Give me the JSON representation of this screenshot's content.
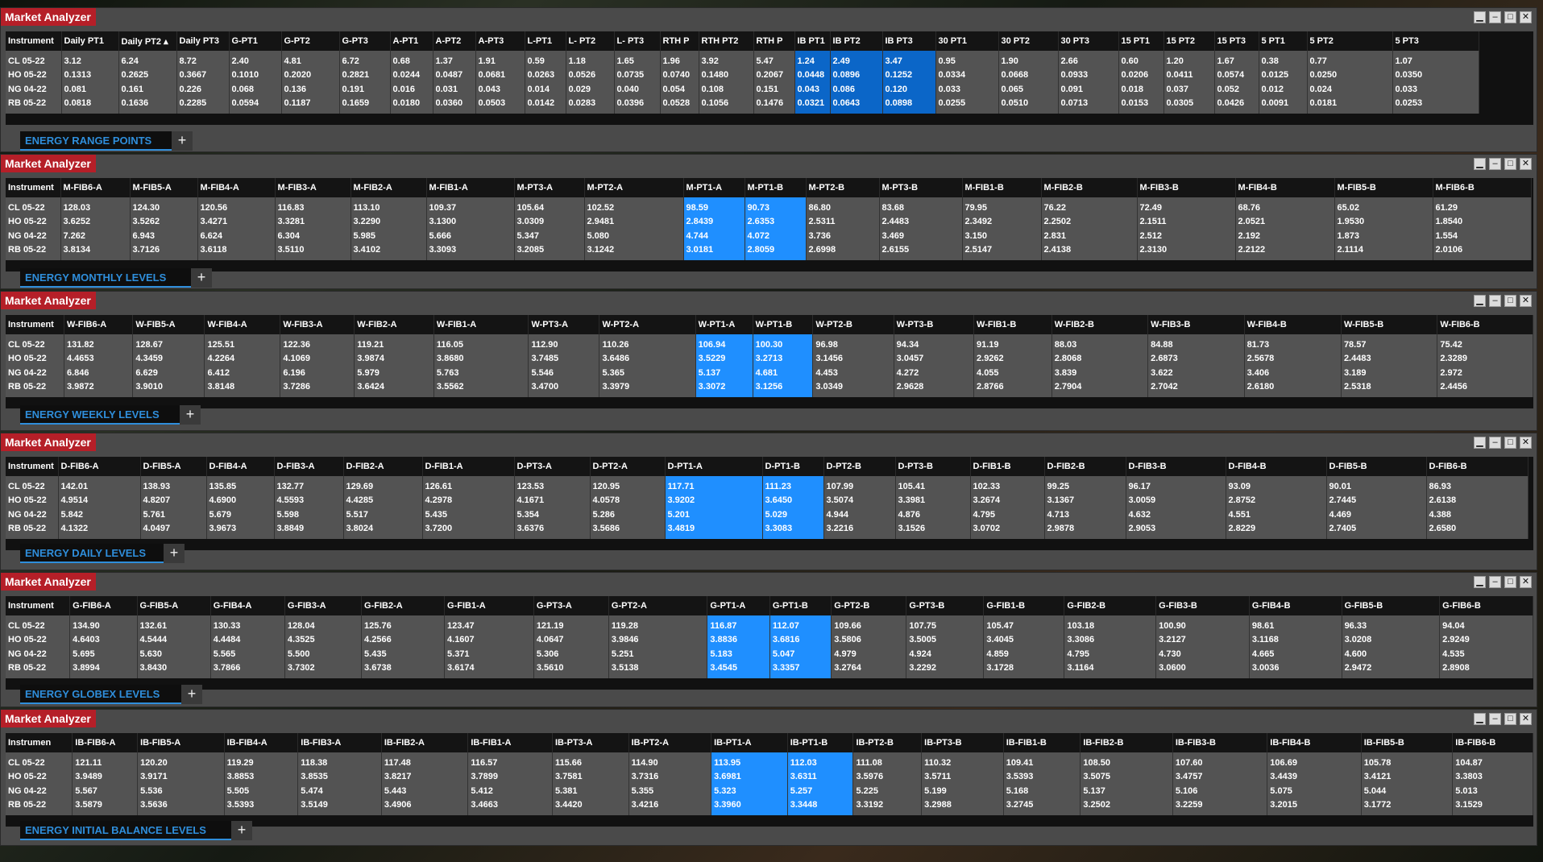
{
  "colors": {
    "title_bg": "#b51f28",
    "highlight": "#1f8fff",
    "tab_text": "#2f8edb"
  },
  "icons": {
    "minimize": "minimize-icon",
    "restore": "restore-icon",
    "maximize": "maximize-icon",
    "close": "close-icon"
  },
  "ctrl_glyphs": {
    "minimize": "▁",
    "restore": "–",
    "maximize": "□",
    "close": "✕"
  },
  "panels": [
    {
      "title": "Market Analyzer",
      "tab_label": "ENERGY RANGE POINTS",
      "add_label": "+",
      "columns": [
        "Instrument",
        "Daily PT1",
        "Daily PT2 ▴",
        "Daily PT3",
        "G-PT1",
        "G-PT2",
        "G-PT3",
        "A-PT1",
        "A-PT2",
        "A-PT3",
        "L-PT1",
        "L- PT2",
        "L- PT3",
        "RTH P",
        "RTH PT2",
        "RTH P",
        "IB PT1",
        "IB PT2",
        "IB PT3",
        "30 PT1",
        "30 PT2",
        "30 PT3",
        "15 PT1",
        "15 PT2",
        "15 PT3",
        "5 PT1",
        "5 PT2",
        "5 PT3"
      ],
      "rows": [
        [
          "CL 05-22",
          "3.12",
          "6.24",
          "8.72",
          "2.40",
          "4.81",
          "6.72",
          "0.68",
          "1.37",
          "1.91",
          "0.59",
          "1.18",
          "1.65",
          "1.96",
          "3.92",
          "5.47",
          "1.24",
          "2.49",
          "3.47",
          "0.95",
          "1.90",
          "2.66",
          "0.60",
          "1.20",
          "1.67",
          "0.38",
          "0.77",
          "1.07"
        ],
        [
          "HO 05-22",
          "0.1313",
          "0.2625",
          "0.3667",
          "0.1010",
          "0.2020",
          "0.2821",
          "0.0244",
          "0.0487",
          "0.0681",
          "0.0263",
          "0.0526",
          "0.0735",
          "0.0740",
          "0.1480",
          "0.2067",
          "0.0448",
          "0.0896",
          "0.1252",
          "0.0334",
          "0.0668",
          "0.0933",
          "0.0206",
          "0.0411",
          "0.0574",
          "0.0125",
          "0.0250",
          "0.0350"
        ],
        [
          "NG 04-22",
          "0.081",
          "0.161",
          "0.226",
          "0.068",
          "0.136",
          "0.191",
          "0.016",
          "0.031",
          "0.043",
          "0.014",
          "0.029",
          "0.040",
          "0.054",
          "0.108",
          "0.151",
          "0.043",
          "0.086",
          "0.120",
          "0.033",
          "0.065",
          "0.091",
          "0.018",
          "0.037",
          "0.052",
          "0.012",
          "0.024",
          "0.033"
        ],
        [
          "RB 05-22",
          "0.0818",
          "0.1636",
          "0.2285",
          "0.0594",
          "0.1187",
          "0.1659",
          "0.0180",
          "0.0360",
          "0.0503",
          "0.0142",
          "0.0283",
          "0.0396",
          "0.0528",
          "0.1056",
          "0.1476",
          "0.0321",
          "0.0643",
          "0.0898",
          "0.0255",
          "0.0510",
          "0.0713",
          "0.0153",
          "0.0305",
          "0.0426",
          "0.0091",
          "0.0181",
          "0.0253"
        ]
      ]
    },
    {
      "title": "Market Analyzer",
      "tab_label": "ENERGY MONTHLY LEVELS",
      "add_label": "+",
      "columns": [
        "Instrument",
        "M-FIB6-A",
        "M-FIB5-A",
        "M-FIB4-A",
        "M-FIB3-A",
        "M-FIB2-A",
        "M-FIB1-A",
        "M-PT3-A",
        "M-PT2-A",
        "M-PT1-A",
        "M-PT1-B",
        "M-PT2-B",
        "M-PT3-B",
        "M-FIB1-B",
        "M-FIB2-B",
        "M-FIB3-B",
        "M-FIB4-B",
        "M-FIB5-B",
        "M-FIB6-B"
      ],
      "rows": [
        [
          "CL 05-22",
          "128.03",
          "124.30",
          "120.56",
          "116.83",
          "113.10",
          "109.37",
          "105.64",
          "102.52",
          "98.59",
          "90.73",
          "86.80",
          "83.68",
          "79.95",
          "76.22",
          "72.49",
          "68.76",
          "65.02",
          "61.29"
        ],
        [
          "HO 05-22",
          "3.6252",
          "3.5262",
          "3.4271",
          "3.3281",
          "3.2290",
          "3.1300",
          "3.0309",
          "2.9481",
          "2.8439",
          "2.6353",
          "2.5311",
          "2.4483",
          "2.3492",
          "2.2502",
          "2.1511",
          "2.0521",
          "1.9530",
          "1.8540"
        ],
        [
          "NG 04-22",
          "7.262",
          "6.943",
          "6.624",
          "6.304",
          "5.985",
          "5.666",
          "5.347",
          "5.080",
          "4.744",
          "4.072",
          "3.736",
          "3.469",
          "3.150",
          "2.831",
          "2.512",
          "2.192",
          "1.873",
          "1.554"
        ],
        [
          "RB 05-22",
          "3.8134",
          "3.7126",
          "3.6118",
          "3.5110",
          "3.4102",
          "3.3093",
          "3.2085",
          "3.1242",
          "3.0181",
          "2.8059",
          "2.6998",
          "2.6155",
          "2.5147",
          "2.4138",
          "2.3130",
          "2.2122",
          "2.1114",
          "2.0106"
        ]
      ]
    },
    {
      "title": "Market Analyzer",
      "tab_label": "ENERGY WEEKLY LEVELS",
      "add_label": "+",
      "columns": [
        "Instrument",
        "W-FIB6-A",
        "W-FIB5-A",
        "W-FIB4-A",
        "W-FIB3-A",
        "W-FIB2-A",
        "W-FIB1-A",
        "W-PT3-A",
        "W-PT2-A",
        "W-PT1-A",
        "W-PT1-B",
        "W-PT2-B",
        "W-PT3-B",
        "W-FIB1-B",
        "W-FIB2-B",
        "W-FIB3-B",
        "W-FIB4-B",
        "W-FIB5-B",
        "W-FIB6-B"
      ],
      "rows": [
        [
          "CL 05-22",
          "131.82",
          "128.67",
          "125.51",
          "122.36",
          "119.21",
          "116.05",
          "112.90",
          "110.26",
          "106.94",
          "100.30",
          "96.98",
          "94.34",
          "91.19",
          "88.03",
          "84.88",
          "81.73",
          "78.57",
          "75.42"
        ],
        [
          "HO 05-22",
          "4.4653",
          "4.3459",
          "4.2264",
          "4.1069",
          "3.9874",
          "3.8680",
          "3.7485",
          "3.6486",
          "3.5229",
          "3.2713",
          "3.1456",
          "3.0457",
          "2.9262",
          "2.8068",
          "2.6873",
          "2.5678",
          "2.4483",
          "2.3289"
        ],
        [
          "NG 04-22",
          "6.846",
          "6.629",
          "6.412",
          "6.196",
          "5.979",
          "5.763",
          "5.546",
          "5.365",
          "5.137",
          "4.681",
          "4.453",
          "4.272",
          "4.055",
          "3.839",
          "3.622",
          "3.406",
          "3.189",
          "2.972"
        ],
        [
          "RB 05-22",
          "3.9872",
          "3.9010",
          "3.8148",
          "3.7286",
          "3.6424",
          "3.5562",
          "3.4700",
          "3.3979",
          "3.3072",
          "3.1256",
          "3.0349",
          "2.9628",
          "2.8766",
          "2.7904",
          "2.7042",
          "2.6180",
          "2.5318",
          "2.4456"
        ]
      ]
    },
    {
      "title": "Market Analyzer",
      "tab_label": "ENERGY DAILY LEVELS",
      "add_label": "+",
      "columns": [
        "Instrument",
        "D-FIB6-A",
        "D-FIB5-A",
        "D-FIB4-A",
        "D-FIB3-A",
        "D-FIB2-A",
        "D-FIB1-A",
        "D-PT3-A",
        "D-PT2-A",
        "D-PT1-A",
        "D-PT1-B",
        "D-PT2-B",
        "D-PT3-B",
        "D-FIB1-B",
        "D-FIB2-B",
        "D-FIB3-B",
        "D-FIB4-B",
        "D-FIB5-B",
        "D-FIB6-B"
      ],
      "rows": [
        [
          "CL 05-22",
          "142.01",
          "138.93",
          "135.85",
          "132.77",
          "129.69",
          "126.61",
          "123.53",
          "120.95",
          "117.71",
          "111.23",
          "107.99",
          "105.41",
          "102.33",
          "99.25",
          "96.17",
          "93.09",
          "90.01",
          "86.93"
        ],
        [
          "HO 05-22",
          "4.9514",
          "4.8207",
          "4.6900",
          "4.5593",
          "4.4285",
          "4.2978",
          "4.1671",
          "4.0578",
          "3.9202",
          "3.6450",
          "3.5074",
          "3.3981",
          "3.2674",
          "3.1367",
          "3.0059",
          "2.8752",
          "2.7445",
          "2.6138"
        ],
        [
          "NG 04-22",
          "5.842",
          "5.761",
          "5.679",
          "5.598",
          "5.517",
          "5.435",
          "5.354",
          "5.286",
          "5.201",
          "5.029",
          "4.944",
          "4.876",
          "4.795",
          "4.713",
          "4.632",
          "4.551",
          "4.469",
          "4.388"
        ],
        [
          "RB 05-22",
          "4.1322",
          "4.0497",
          "3.9673",
          "3.8849",
          "3.8024",
          "3.7200",
          "3.6376",
          "3.5686",
          "3.4819",
          "3.3083",
          "3.2216",
          "3.1526",
          "3.0702",
          "2.9878",
          "2.9053",
          "2.8229",
          "2.7405",
          "2.6580"
        ]
      ]
    },
    {
      "title": "Market Analyzer",
      "tab_label": "ENERGY GLOBEX LEVELS",
      "add_label": "+",
      "columns": [
        "Instrument",
        "G-FIB6-A",
        "G-FIB5-A",
        "G-FIB4-A",
        "G-FIB3-A",
        "G-FIB2-A",
        "G-FIB1-A",
        "G-PT3-A",
        "G-PT2-A",
        "G-PT1-A",
        "G-PT1-B",
        "G-PT2-B",
        "G-PT3-B",
        "G-FIB1-B",
        "G-FIB2-B",
        "G-FIB3-B",
        "G-FIB4-B",
        "G-FIB5-B",
        "G-FIB6-B"
      ],
      "rows": [
        [
          "CL 05-22",
          "134.90",
          "132.61",
          "130.33",
          "128.04",
          "125.76",
          "123.47",
          "121.19",
          "119.28",
          "116.87",
          "112.07",
          "109.66",
          "107.75",
          "105.47",
          "103.18",
          "100.90",
          "98.61",
          "96.33",
          "94.04"
        ],
        [
          "HO 05-22",
          "4.6403",
          "4.5444",
          "4.4484",
          "4.3525",
          "4.2566",
          "4.1607",
          "4.0647",
          "3.9846",
          "3.8836",
          "3.6816",
          "3.5806",
          "3.5005",
          "3.4045",
          "3.3086",
          "3.2127",
          "3.1168",
          "3.0208",
          "2.9249"
        ],
        [
          "NG 04-22",
          "5.695",
          "5.630",
          "5.565",
          "5.500",
          "5.435",
          "5.371",
          "5.306",
          "5.251",
          "5.183",
          "5.047",
          "4.979",
          "4.924",
          "4.859",
          "4.795",
          "4.730",
          "4.665",
          "4.600",
          "4.535"
        ],
        [
          "RB 05-22",
          "3.8994",
          "3.8430",
          "3.7866",
          "3.7302",
          "3.6738",
          "3.6174",
          "3.5610",
          "3.5138",
          "3.4545",
          "3.3357",
          "3.2764",
          "3.2292",
          "3.1728",
          "3.1164",
          "3.0600",
          "3.0036",
          "2.9472",
          "2.8908"
        ]
      ]
    },
    {
      "title": "Market Analyzer",
      "tab_label": "ENERGY INITIAL BALANCE LEVELS",
      "add_label": "+",
      "columns": [
        "Instrumen",
        "IB-FIB6-A",
        "IB-FIB5-A",
        "IB-FIB4-A",
        "IB-FIB3-A",
        "IB-FIB2-A",
        "IB-FIB1-A",
        "IB-PT3-A",
        "IB-PT2-A",
        "IB-PT1-A",
        "IB-PT1-B",
        "IB-PT2-B",
        "IB-PT3-B",
        "IB-FIB1-B",
        "IB-FIB2-B",
        "IB-FIB3-B",
        "IB-FIB4-B",
        "IB-FIB5-B",
        "IB-FIB6-B"
      ],
      "rows": [
        [
          "CL 05-22",
          "121.11",
          "120.20",
          "119.29",
          "118.38",
          "117.48",
          "116.57",
          "115.66",
          "114.90",
          "113.95",
          "112.03",
          "111.08",
          "110.32",
          "109.41",
          "108.50",
          "107.60",
          "106.69",
          "105.78",
          "104.87"
        ],
        [
          "HO 05-22",
          "3.9489",
          "3.9171",
          "3.8853",
          "3.8535",
          "3.8217",
          "3.7899",
          "3.7581",
          "3.7316",
          "3.6981",
          "3.6311",
          "3.5976",
          "3.5711",
          "3.5393",
          "3.5075",
          "3.4757",
          "3.4439",
          "3.4121",
          "3.3803"
        ],
        [
          "NG 04-22",
          "5.567",
          "5.536",
          "5.505",
          "5.474",
          "5.443",
          "5.412",
          "5.381",
          "5.355",
          "5.323",
          "5.257",
          "5.225",
          "5.199",
          "5.168",
          "5.137",
          "5.106",
          "5.075",
          "5.044",
          "5.013"
        ],
        [
          "RB 05-22",
          "3.5879",
          "3.5636",
          "3.5393",
          "3.5149",
          "3.4906",
          "3.4663",
          "3.4420",
          "3.4216",
          "3.3960",
          "3.3448",
          "3.3192",
          "3.2988",
          "3.2745",
          "3.2502",
          "3.2259",
          "3.2015",
          "3.1772",
          "3.1529"
        ]
      ]
    }
  ]
}
